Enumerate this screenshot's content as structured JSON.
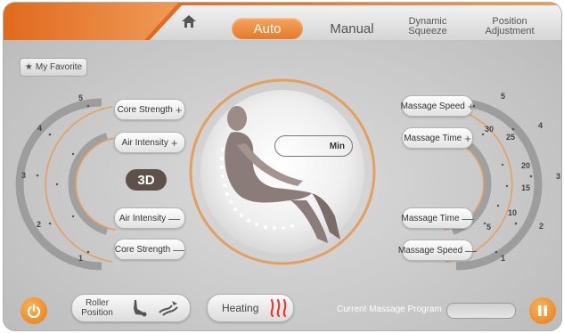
{
  "tabs": {
    "home_icon": "home-icon",
    "auto": "Auto",
    "manual": "Manual",
    "dynamic_line1": "Dynamic",
    "dynamic_line2": "Squeeze",
    "position_line1": "Position",
    "position_line2": "Adjustment"
  },
  "favorite": {
    "label": "My Favorite",
    "icon": "star-icon"
  },
  "left_controls": {
    "core_strength_up": "Core Strength",
    "air_intensity_up": "Air Intensity",
    "air_intensity_down": "Air Intensity",
    "core_strength_down": "Core Strength",
    "plus_symbol": "+",
    "minus_symbol": "—",
    "mode_badge": "3D"
  },
  "left_scale": [
    "5",
    "4",
    "3",
    "2",
    "1"
  ],
  "right_controls": {
    "massage_speed_up": "Massage Speed",
    "massage_time_up": "Massage Time",
    "massage_time_down": "Massage Time",
    "massage_speed_down": "Massage Speed"
  },
  "right_scale_outer": [
    "5",
    "4",
    "3",
    "2",
    "1"
  ],
  "right_scale_inner": [
    "30",
    "25",
    "20",
    "15",
    "10",
    "5"
  ],
  "timer": {
    "unit": "Min",
    "value": ""
  },
  "bottom": {
    "roller_line1": "Roller",
    "roller_line2": "Position",
    "heating": "Heating",
    "current_program_label": "Current Massage Program",
    "current_program_value": ""
  },
  "colors": {
    "accent": "#e8832a",
    "arc": "#e3a061",
    "badge": "#5e5149"
  }
}
